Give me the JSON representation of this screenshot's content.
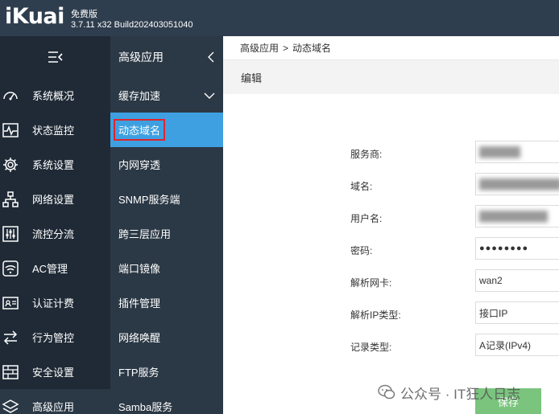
{
  "app": {
    "logo_text": "iKuai",
    "edition": "免费版",
    "version": "3.7.11 x32 Build202403051040"
  },
  "sidebar": {
    "toggle_icon": "menu-collapse-icon",
    "items": [
      {
        "label": "系统概况",
        "icon": "dashboard-icon"
      },
      {
        "label": "状态监控",
        "icon": "monitor-pulse-icon"
      },
      {
        "label": "系统设置",
        "icon": "gear-icon"
      },
      {
        "label": "网络设置",
        "icon": "network-topology-icon"
      },
      {
        "label": "流控分流",
        "icon": "sliders-icon"
      },
      {
        "label": "AC管理",
        "icon": "wifi-icon"
      },
      {
        "label": "认证计费",
        "icon": "id-card-icon"
      },
      {
        "label": "行为管控",
        "icon": "arrows-exchange-icon"
      },
      {
        "label": "安全设置",
        "icon": "firewall-icon"
      },
      {
        "label": "高级应用",
        "icon": "layers-icon"
      }
    ]
  },
  "subnav": {
    "title": "高级应用",
    "items": [
      {
        "label": "缓存加速"
      },
      {
        "label": "动态域名"
      },
      {
        "label": "内网穿透"
      },
      {
        "label": "SNMP服务端"
      },
      {
        "label": "跨三层应用"
      },
      {
        "label": "端口镜像"
      },
      {
        "label": "插件管理"
      },
      {
        "label": "网络唤醒"
      },
      {
        "label": "FTP服务"
      },
      {
        "label": "Samba服务"
      }
    ]
  },
  "main": {
    "breadcrumb": {
      "parent": "高级应用",
      "separator": ">",
      "current": "动态域名"
    },
    "panel_title": "编辑",
    "form": {
      "provider": {
        "label": "服务商:",
        "value": "(blurred)"
      },
      "domain": {
        "label": "域名:",
        "value": "(blurred)"
      },
      "username": {
        "label": "用户名:",
        "value": "(blurred)"
      },
      "password": {
        "label": "密码:",
        "value": "●●●●●●●●"
      },
      "interface": {
        "label": "解析网卡:",
        "value": "wan2"
      },
      "ip_type": {
        "label": "解析IP类型:",
        "value": "接口IP"
      },
      "record_type": {
        "label": "记录类型:",
        "value": "A记录(IPv4)"
      }
    },
    "save_label": "保存"
  },
  "watermark": {
    "text": "公众号 · IT狂人日志"
  },
  "colors": {
    "topbar": "#2f3e4e",
    "sidebar": "#1f2a36",
    "subnav": "#2b3845",
    "active": "#3ea0e0",
    "highlight_border": "#e0242c",
    "save_button": "#7ac47e"
  }
}
